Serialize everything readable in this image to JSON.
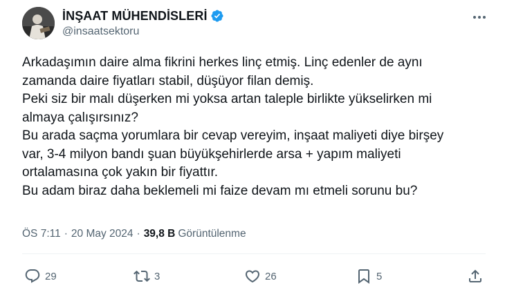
{
  "author": {
    "display_name": "İNŞAAT MÜHENDİSLERİ",
    "handle": "@insaatsektoru",
    "verified": true,
    "verified_color": "#1d9bf0"
  },
  "tweet": {
    "lines": [
      "Arkadaşımın daire alma fikrini herkes linç etmiş. Linç edenler de aynı",
      "zamanda daire fiyatları stabil, düşüyor filan demiş.",
      "Peki siz bir malı düşerken mi yoksa artan taleple birlikte yükselirken mi",
      "almaya çalışırsınız?",
      "Bu arada saçma yorumlara bir cevap vereyim, inşaat maliyeti diye birşey",
      "var, 3-4 milyon bandı şuan büyükşehirlerde arsa + yapım maliyeti",
      "ortalamasına çok yakın bir fiyattır.",
      "Bu adam biraz daha beklemeli mi faize devam mı etmeli sorunu bu?"
    ]
  },
  "meta": {
    "time": "ÖS 7:11",
    "separator": "·",
    "date": "20 May 2024",
    "views_count": "39,8 B",
    "views_label": "Görüntülenme"
  },
  "actions": {
    "reply": {
      "icon": "reply-icon",
      "count": "29"
    },
    "retweet": {
      "icon": "retweet-icon",
      "count": "3"
    },
    "like": {
      "icon": "heart-icon",
      "count": "26"
    },
    "bookmark": {
      "icon": "bookmark-icon",
      "count": "5"
    },
    "share": {
      "icon": "share-icon"
    }
  },
  "colors": {
    "text": "#0f1419",
    "secondary": "#536471",
    "divider": "#eff3f4"
  }
}
